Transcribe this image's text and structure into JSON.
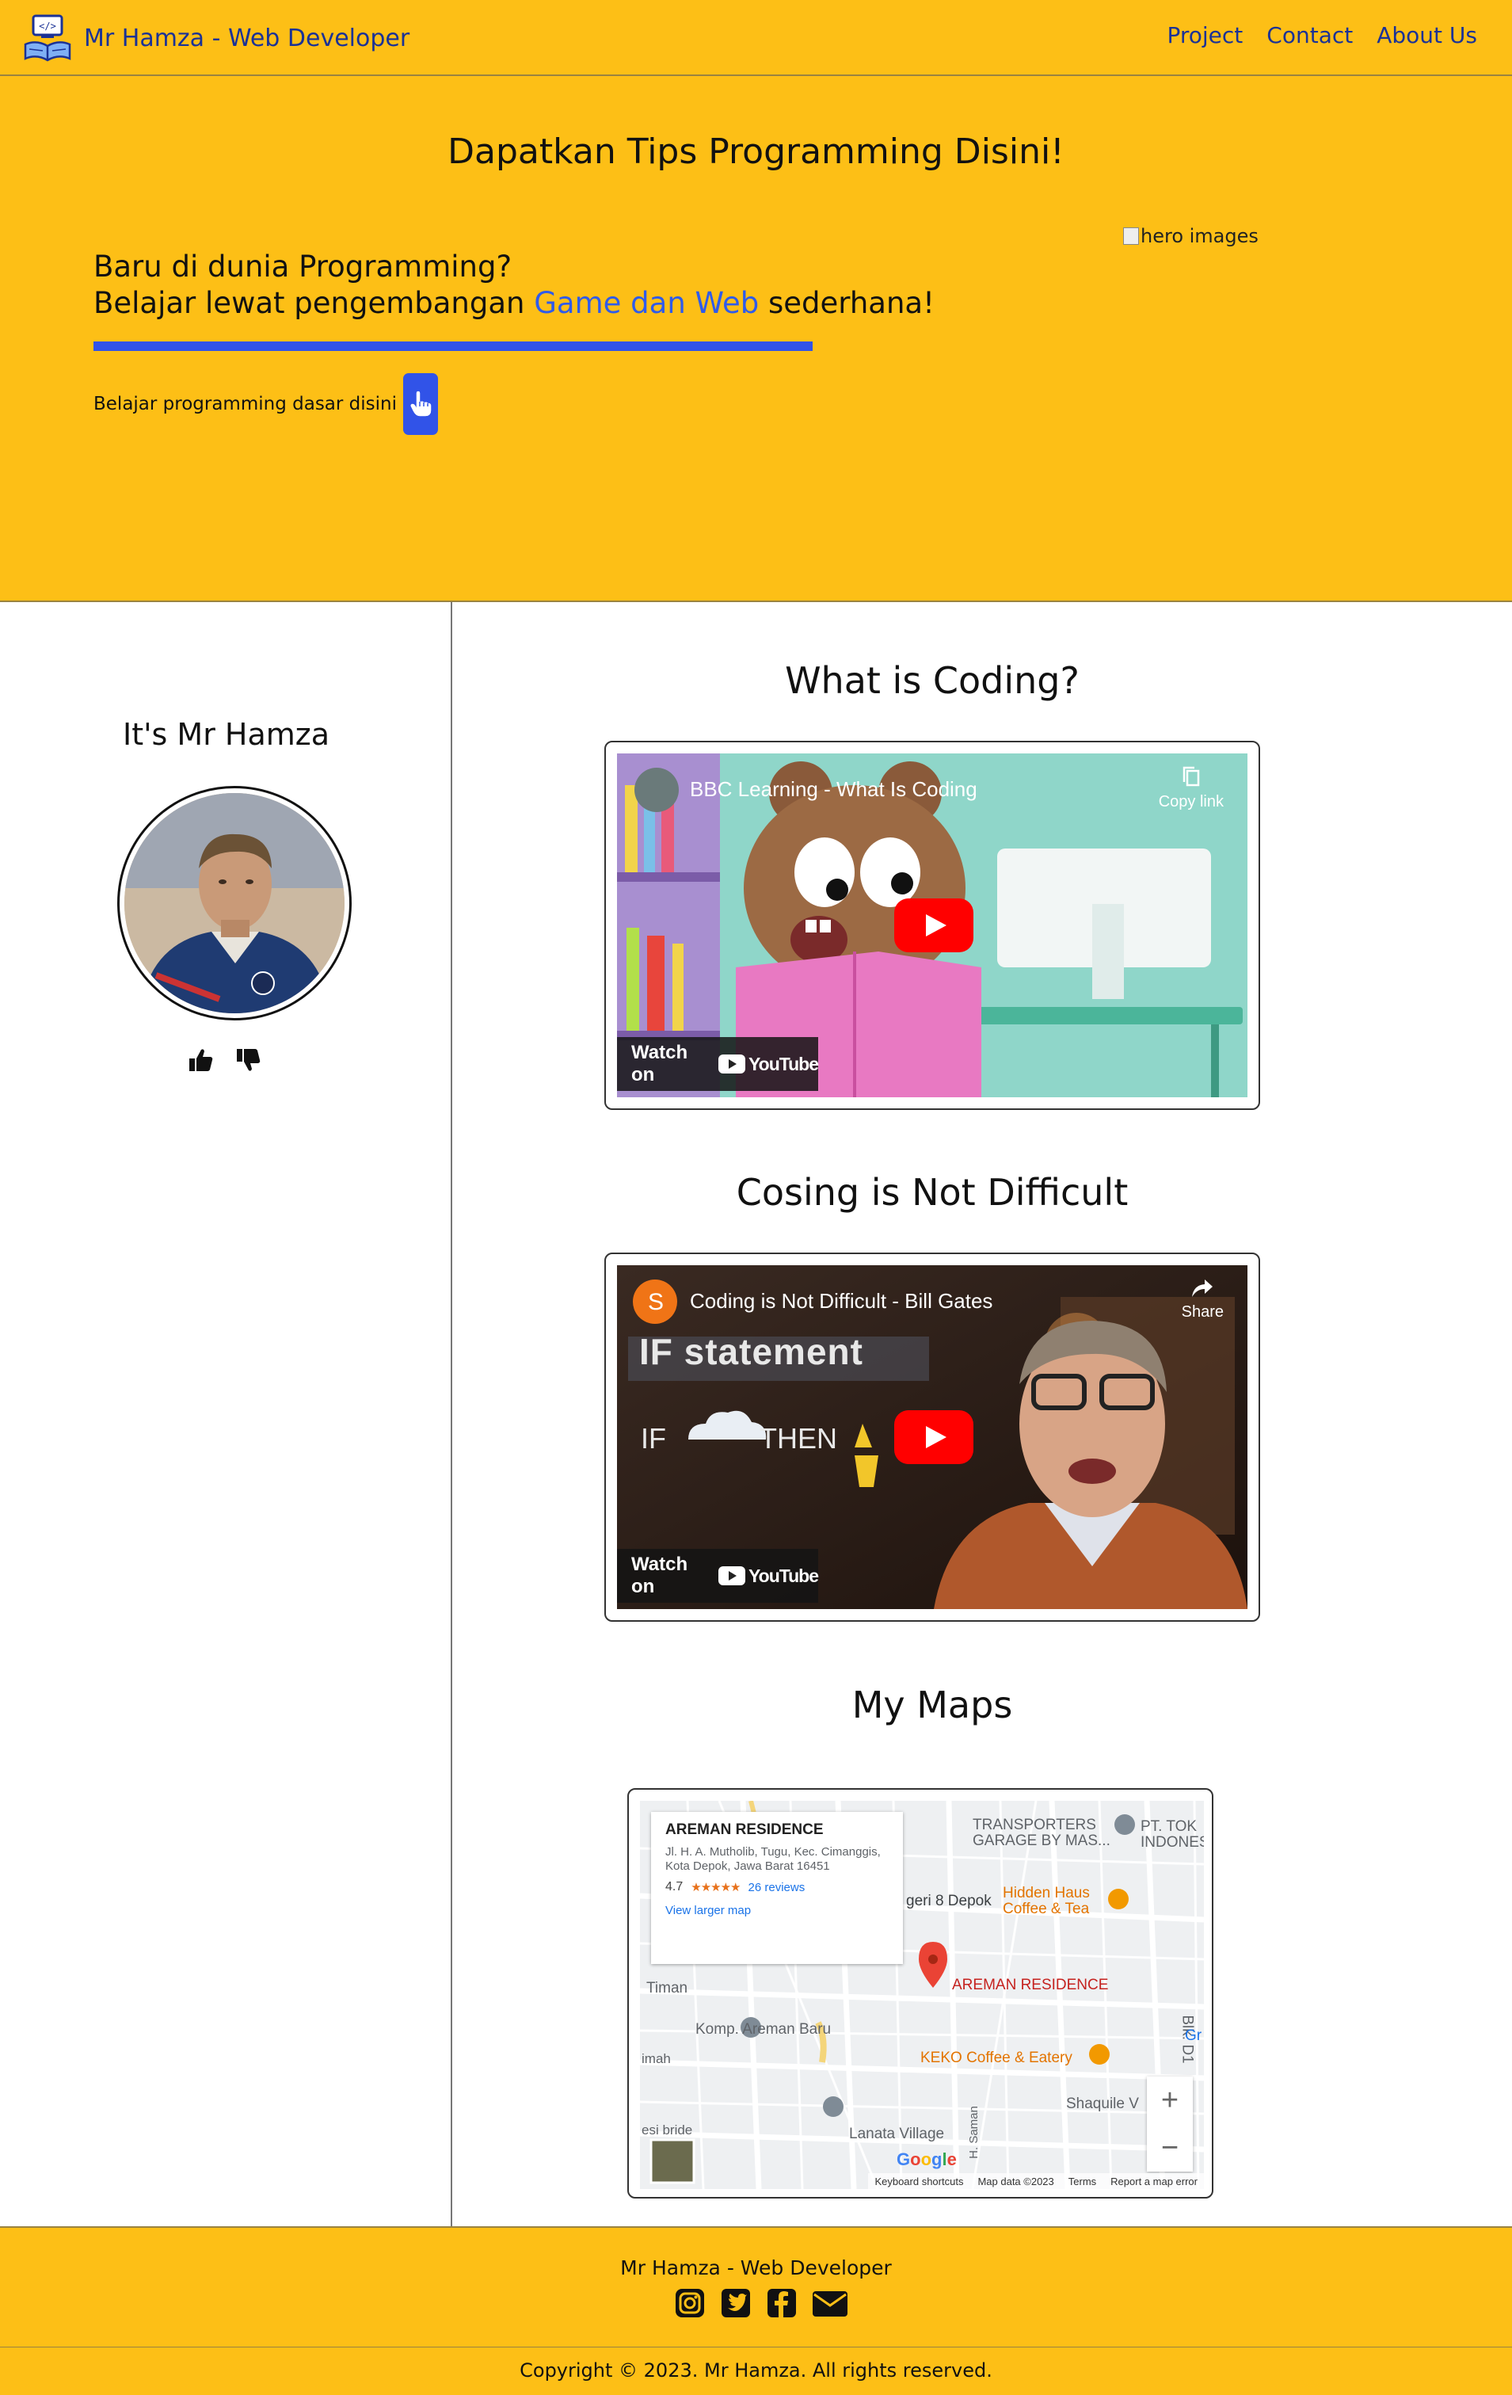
{
  "nav": {
    "brand": "Mr Hamza - Web Developer",
    "links": [
      "Project",
      "Contact",
      "About Us"
    ],
    "logo_icon": "laptop-book-icon"
  },
  "hero": {
    "title": "Dapatkan Tips Programming Disini!",
    "subtitle_line1": "Baru di dunia Programming?",
    "subtitle_line2_pre": "Belajar lewat pengembangan ",
    "subtitle_line2_accent": "Game dan Web",
    "subtitle_line2_post": " sederhana!",
    "image_alt": "hero images",
    "cta_text": "Belajar programming dasar disini",
    "cta_icon": "pointer-hand-icon",
    "accent_color": "#3153e8",
    "background": "#fdbf16"
  },
  "sidebar": {
    "title": "It's Mr Hamza",
    "like_icon": "thumbs-up-icon",
    "dislike_icon": "thumbs-down-icon"
  },
  "sections": [
    {
      "title": "What is Coding?",
      "video_title": "BBC Learning - What Is Coding",
      "action": "Copy link",
      "watch_on": "Watch on",
      "yt": "YouTube"
    },
    {
      "title": "Cosing is Not Difficult",
      "video_title": "Coding is Not Difficult - Bill Gates",
      "action": "Share",
      "watch_on": "Watch on",
      "yt": "YouTube",
      "channel_initial": "S",
      "overlay_text_1": "IF statement",
      "overlay_text_2": "IF",
      "overlay_text_3": "THEN"
    }
  ],
  "maps": {
    "title": "My Maps",
    "place_name": "AREMAN RESIDENCE",
    "address": "Jl. H. A. Mutholib, Tugu, Kec. Cimanggis, Kota Depok, Jawa Barat 16451",
    "rating": "4.7",
    "stars": "★★★★★",
    "reviews": "26 reviews",
    "larger_map": "View larger map",
    "labels": {
      "transporters": "TRANSPORTERS",
      "garage": "GARAGE BY MAS...",
      "pt": "PT. TOK",
      "indones": "INDONES",
      "sma": "geri 8 Depok",
      "hidden": "Hidden Haus",
      "coffee": "Coffee & Tea",
      "areman_pin": "AREMAN RESIDENCE",
      "komp": "Komp. Areman Baru",
      "keko": "KEKO Coffee & Eatery",
      "shaquile": "Shaquile V",
      "lanata": "Lanata Village",
      "timan": "Timan",
      "blk": "Blk. D1",
      "gr": "Gr",
      "saman": "H. Saman",
      "imah": "imah",
      "bride": "esi bride"
    },
    "zoom_in": "+",
    "zoom_out": "−",
    "google": "Google",
    "footer_links": [
      "Keyboard shortcuts",
      "Map data ©2023",
      "Terms",
      "Report a map error"
    ]
  },
  "footer": {
    "brand": "Mr Hamza - Web Developer",
    "social_icons": [
      "instagram-icon",
      "twitter-icon",
      "facebook-icon",
      "envelope-icon"
    ],
    "copyright": "Copyright © 2023. Mr Hamza. All rights reserved."
  }
}
